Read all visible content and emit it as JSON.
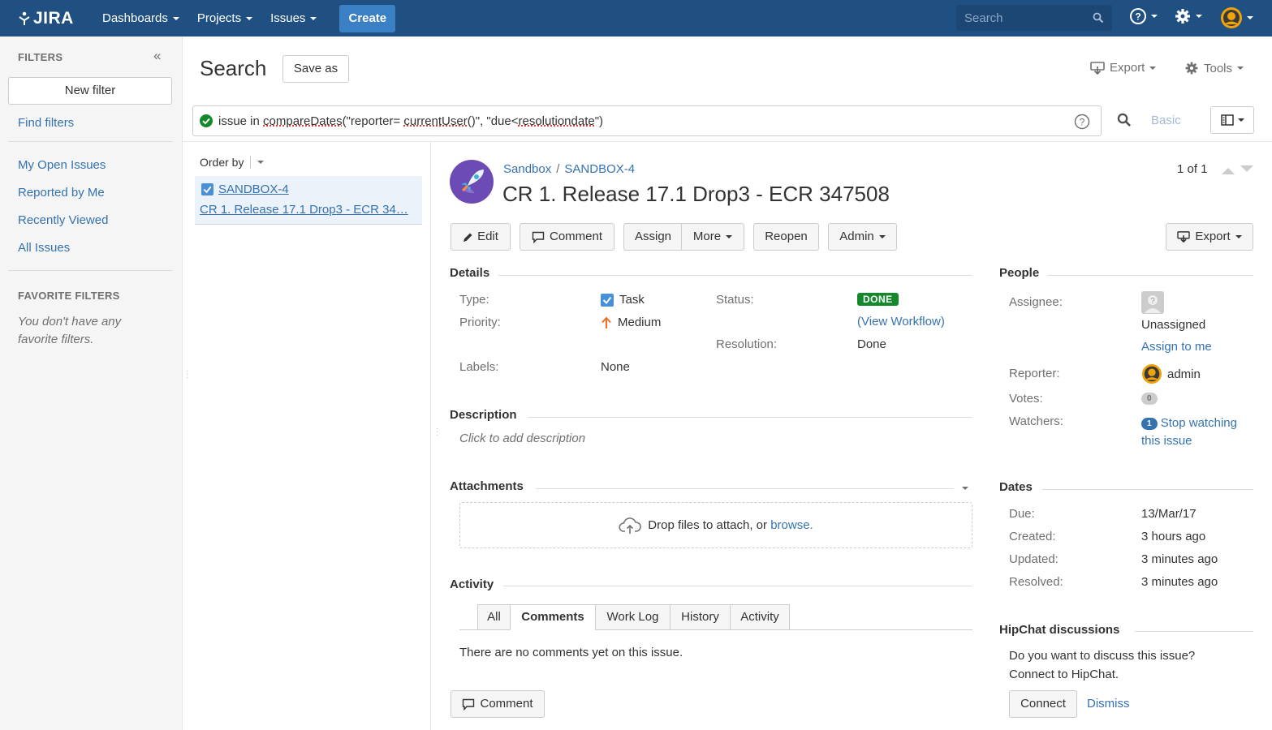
{
  "header": {
    "logo": "JIRA",
    "nav": [
      {
        "label": "Dashboards"
      },
      {
        "label": "Projects"
      },
      {
        "label": "Issues"
      }
    ],
    "create": "Create",
    "search_placeholder": "Search"
  },
  "sidebar": {
    "filters_heading": "FILTERS",
    "new_filter": "New filter",
    "find_filters": "Find filters",
    "links": [
      "My Open Issues",
      "Reported by Me",
      "Recently Viewed",
      "All Issues"
    ],
    "favorite_heading": "FAVORITE FILTERS",
    "favorite_empty": "You don't have any favorite filters."
  },
  "toolbar": {
    "title": "Search",
    "save_as": "Save as",
    "export": "Export",
    "tools": "Tools"
  },
  "jql": {
    "prefix": "issue in ",
    "fn": "compareDates",
    "p1": "(\"reporter= ",
    "fn2": "currentUser",
    "p2": "()\", \"due<",
    "field": "resolutiondate",
    "p3": "\")",
    "basic": "Basic"
  },
  "list": {
    "order_by": "Order by",
    "item_key": "SANDBOX-4",
    "item_summary": "CR 1. Release 17.1 Drop3 - ECR 34…"
  },
  "issue": {
    "project": "Sandbox",
    "key": "SANDBOX-4",
    "title": "CR 1. Release 17.1 Drop3 - ECR 347508",
    "pager": "1 of 1",
    "actions": {
      "edit": "Edit",
      "comment": "Comment",
      "assign": "Assign",
      "more": "More",
      "reopen": "Reopen",
      "admin": "Admin",
      "export": "Export"
    },
    "details": {
      "heading": "Details",
      "type_label": "Type:",
      "type_value": "Task",
      "priority_label": "Priority:",
      "priority_value": "Medium",
      "labels_label": "Labels:",
      "labels_value": "None",
      "status_label": "Status:",
      "status_value": "DONE",
      "view_workflow": "View Workflow",
      "resolution_label": "Resolution:",
      "resolution_value": "Done"
    },
    "description": {
      "heading": "Description",
      "placeholder": "Click to add description"
    },
    "attachments": {
      "heading": "Attachments",
      "drop_text": "Drop files to attach, or ",
      "browse": "browse."
    },
    "activity": {
      "heading": "Activity",
      "tabs": [
        "All",
        "Comments",
        "Work Log",
        "History",
        "Activity"
      ],
      "empty": "There are no comments yet on this issue.",
      "comment_button": "Comment"
    },
    "people": {
      "heading": "People",
      "assignee_label": "Assignee:",
      "assignee_value": "Unassigned",
      "assign_to_me": "Assign to me",
      "reporter_label": "Reporter:",
      "reporter_value": "admin",
      "votes_label": "Votes:",
      "votes_value": "0",
      "watchers_label": "Watchers:",
      "watchers_count": "1",
      "stop_watching_1": "Stop watching",
      "stop_watching_2": "this issue"
    },
    "dates": {
      "heading": "Dates",
      "due_label": "Due:",
      "due_value": "13/Mar/17",
      "created_label": "Created:",
      "created_value": "3 hours ago",
      "updated_label": "Updated:",
      "updated_value": "3 minutes ago",
      "resolved_label": "Resolved:",
      "resolved_value": "3 minutes ago"
    },
    "hipchat": {
      "heading": "HipChat discussions",
      "line1": "Do you want to discuss this issue?",
      "line2": "Connect to HipChat.",
      "connect": "Connect",
      "dismiss": "Dismiss"
    }
  },
  "colors": {
    "header_bg": "#205081",
    "create_bg": "#3b7fc4",
    "link": "#3572b0",
    "done_badge": "#14892c"
  }
}
